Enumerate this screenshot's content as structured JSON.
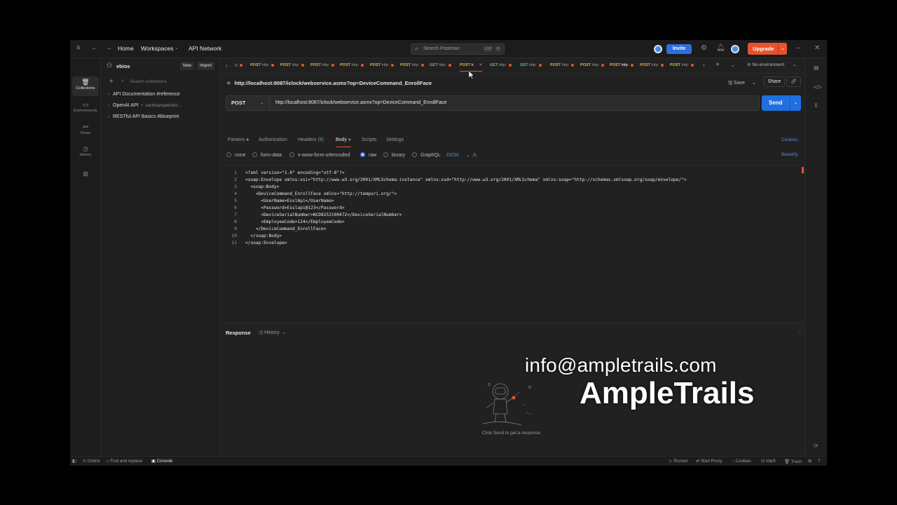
{
  "header": {
    "home": "Home",
    "workspaces": "Workspaces",
    "api_network": "API Network",
    "search_placeholder": "Search Postman",
    "kbd_ctrl": "Ctrl",
    "kbd_k": "K",
    "invite": "Invite",
    "upgrade": "Upgrade"
  },
  "rail": {
    "collections": "Collections",
    "environments": "Environments",
    "flows": "Flows",
    "history": "History"
  },
  "sidebar": {
    "workspace_name": "ebios",
    "new_label": "New",
    "import_label": "Import",
    "search_placeholder": "Search collections",
    "collections": [
      {
        "name": "API Documentation #reference",
        "sub": ""
      },
      {
        "name": "OpenAI API",
        "sub": "sachinampletrails'..."
      },
      {
        "name": "RESTful API Basics #blueprint",
        "sub": ""
      }
    ]
  },
  "tabs": [
    {
      "method": "",
      "label": ":g"
    },
    {
      "method": "POST",
      "label": "http:"
    },
    {
      "method": "POST",
      "label": "http:"
    },
    {
      "method": "POST",
      "label": "http:"
    },
    {
      "method": "POST",
      "label": "http:"
    },
    {
      "method": "POST",
      "label": "http:"
    },
    {
      "method": "POST",
      "label": "http:"
    },
    {
      "method": "GET",
      "label": "http:"
    },
    {
      "method": "POST",
      "label": "h"
    },
    {
      "method": "GET",
      "label": "http:"
    },
    {
      "method": "GET",
      "label": "http:"
    },
    {
      "method": "POST",
      "label": "http:"
    },
    {
      "method": "POST",
      "label": "http:"
    },
    {
      "method": "POST",
      "label": "http:"
    },
    {
      "method": "POST",
      "label": "http:"
    },
    {
      "method": "POST",
      "label": "http:"
    }
  ],
  "environment": "No environment",
  "request": {
    "title": "http://localhost:8087/iclock/webservice.asmx?op=DeviceCommand_EnrollFace",
    "save": "Save",
    "share": "Share",
    "method": "POST",
    "url": "http://localhost:8087/iclock/webservice.asmx?op=DeviceCommand_EnrollFace",
    "send": "Send"
  },
  "subtabs": {
    "params": "Params",
    "authorization": "Authorization",
    "headers": "Headers",
    "headers_count": "(9)",
    "body": "Body",
    "scripts": "Scripts",
    "settings": "Settings",
    "cookies": "Cookies"
  },
  "body_options": {
    "none": "none",
    "form_data": "form-data",
    "urlencoded": "x-www-form-urlencoded",
    "raw": "raw",
    "binary": "binary",
    "graphql": "GraphQL",
    "format": "JSON",
    "beautify": "Beautify"
  },
  "code_lines": [
    {
      "n": "1",
      "t": "<?xml version=\"1.0\" encoding=\"utf-8\"?>"
    },
    {
      "n": "2",
      "t": "<soap:Envelope xmlns:xsi=\"http://www.w3.org/2001/XMLSchema-instance\" xmlns:xsd=\"http://www.w3.org/2001/XMLSchema\" xmlns:soap=\"http://schemas.xmlsoap.org/soap/envelope/\">"
    },
    {
      "n": "3",
      "t": "  <soap:Body>"
    },
    {
      "n": "4",
      "t": "    <DeviceCommand_EnrollFace xmlns=\"http://tempuri.org/\">"
    },
    {
      "n": "5",
      "t": "      <UserName>EsslApi</UserName>"
    },
    {
      "n": "6",
      "t": "      <Password>Esslapi@123</Password>"
    },
    {
      "n": "7",
      "t": "      <DeviceSerialNumber>NCD8252100472</DeviceSerialNumber>"
    },
    {
      "n": "8",
      "t": "      <EmployeeCode>124</EmployeeCode>"
    },
    {
      "n": "9",
      "t": "    </DeviceCommand_EnrollFace>"
    },
    {
      "n": "10",
      "t": "  </soap:Body>"
    },
    {
      "n": "11",
      "t": "</soap:Envelope>"
    }
  ],
  "response": {
    "label": "Response",
    "history": "History",
    "empty_text": "Click Send to get a response"
  },
  "statusbar": {
    "online": "Online",
    "find_replace": "Find and replace",
    "console": "Console",
    "runner": "Runner",
    "start_proxy": "Start Proxy",
    "cookies": "Cookies",
    "vault": "Vault",
    "trash": "Trash"
  },
  "watermark": {
    "email": "info@ampletrails.com",
    "brand": "AmpleTrails"
  },
  "colors": {
    "accent": "#e8522c",
    "primary": "#1f6fe0",
    "post": "#e6b34a",
    "get": "#6cc077"
  }
}
